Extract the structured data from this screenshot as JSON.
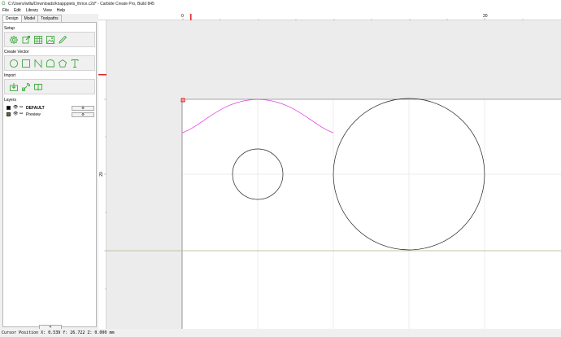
{
  "window": {
    "title": "C:/Users/willa/Downloads/knapppiets_thrice.c2d* - Carbide Create Pro, Build 845"
  },
  "menu": [
    "File",
    "Edit",
    "Library",
    "View",
    "Help"
  ],
  "tabs": [
    "Design",
    "Model",
    "Toolpaths"
  ],
  "sections": {
    "setup": "Setup",
    "create_vector": "Create Vector",
    "import": "Import",
    "layers": "Layers"
  },
  "layers": [
    {
      "name": "DEFAULT",
      "color": "#000000",
      "bold": true
    },
    {
      "name": "Preview",
      "color": "#7a6a00",
      "bold": false
    }
  ],
  "add_layer_label": "+",
  "ruler": {
    "top_labels": [
      "0",
      "20"
    ],
    "left_labels": [
      "20"
    ]
  },
  "status": {
    "text": "Cursor Position X: 0.539 Y: 26.722 Z: 0.000 mm"
  },
  "colors": {
    "accent_green": "#3aa83a",
    "selection_curve": "#e040e0",
    "origin_red": "#e02020",
    "axis_line": "#b8b890"
  },
  "icons": {
    "setup": [
      "gear-icon",
      "document-icon",
      "grid-icon",
      "image-icon",
      "pen-icon"
    ],
    "create_vector": [
      "circle-icon",
      "rectangle-icon",
      "curve-icon",
      "polygon-icon",
      "pentagon-icon",
      "text-icon"
    ],
    "import": [
      "import-icon",
      "wrench-icon",
      "book-icon"
    ]
  }
}
